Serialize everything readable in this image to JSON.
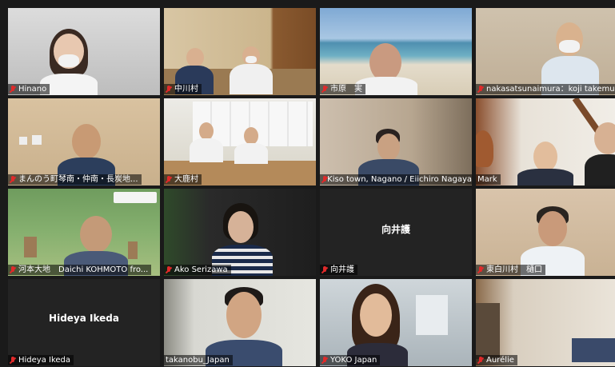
{
  "participants": [
    {
      "name": "Hinano"
    },
    {
      "name": "中川村"
    },
    {
      "name": "市原　実"
    },
    {
      "name": "nakasatsunaimura：koji takemura"
    },
    {
      "name": "まんのう町琴南・仲南・長炭地..."
    },
    {
      "name": "大鹿村"
    },
    {
      "name": "Kiso town, Nagano / Eiichiro Nagaya"
    },
    {
      "name": "Mark"
    },
    {
      "name": "河本大地　Daichi KOHMOTO fro..."
    },
    {
      "name": "Ako Serizawa"
    },
    {
      "name": "向井護",
      "center_label": "向井護"
    },
    {
      "name": "東白川村　樋口"
    },
    {
      "name": "Hideya Ikeda",
      "center_label": "Hideya Ikeda"
    },
    {
      "name": "takanobu_Japan"
    },
    {
      "name": "YOKO Japan"
    },
    {
      "name": "Aurélie"
    }
  ],
  "colors": {
    "background": "#1a1a1a",
    "active_speaker": "#c3e84a",
    "muted_mic": "#e02a2a"
  }
}
